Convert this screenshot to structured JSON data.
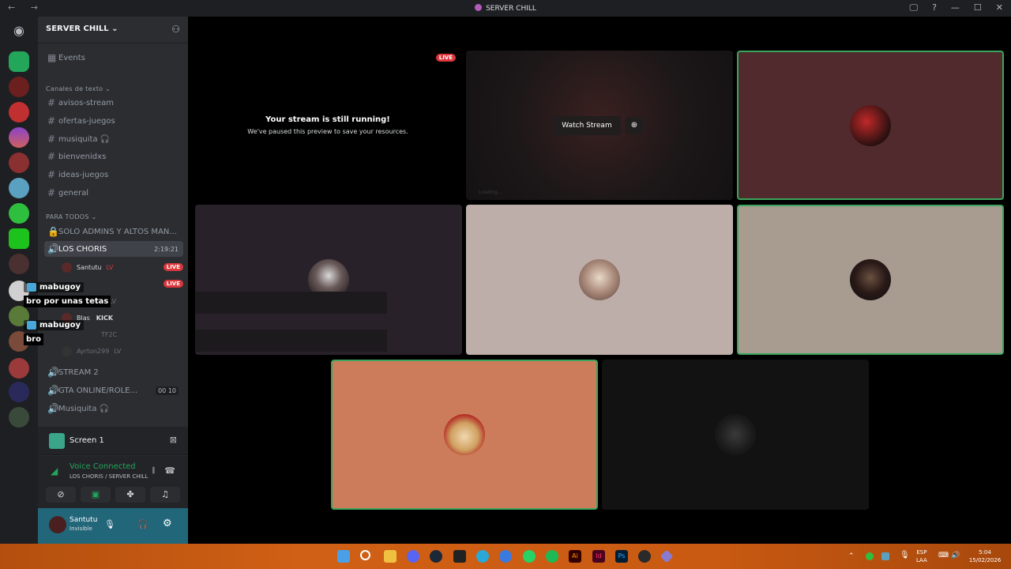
{
  "window": {
    "title": "SERVER CHILL",
    "nav_arrows": "← →",
    "controls": [
      "🖵",
      "?",
      "—",
      "☐",
      "✕"
    ]
  },
  "guild": {
    "name": "SERVER CHILL"
  },
  "sidebar": {
    "events_label": "Events",
    "category_text": "Canales de texto",
    "text_channels": [
      "avisos-stream",
      "ofertas-juegos",
      "musiquita 🎧",
      "bienvenidxs",
      "ideas-juegos",
      "general"
    ],
    "category_voice": "PARA TODOS",
    "locked_channel": "SOLO ADMINS Y ALTOS MAN...",
    "active_voice": {
      "name": "LOS CHORIS",
      "timer": "2:19:21",
      "users": [
        {
          "name": "Santutu",
          "badge": "LV",
          "status": "LIVE"
        },
        {
          "name": "",
          "badge": "",
          "status": "LIVE"
        },
        {
          "name": "",
          "badge": "LV",
          "status": ""
        },
        {
          "name": "Blas",
          "badge": "KICK",
          "status": ""
        },
        {
          "name": "",
          "badge": "TF2C",
          "status": ""
        },
        {
          "name": "Ayrton299",
          "badge": "LV",
          "status": ""
        }
      ]
    },
    "other_voice": [
      {
        "name": "STREAM 2",
        "counts": ""
      },
      {
        "name": "GTA ONLINE/ROLE...",
        "counts": [
          "00",
          "10"
        ]
      },
      {
        "name": "Musiquita 🎧",
        "counts": ""
      }
    ]
  },
  "chat_overlay": [
    {
      "user": "mabugoy",
      "message": "bro por unas tetas"
    },
    {
      "user": "mabugoy",
      "message": "bro"
    }
  ],
  "screen_panel": {
    "label": "Screen 1"
  },
  "voice_panel": {
    "status": "Voice Connected",
    "location": "LOS CHORIS / SERVER CHILL"
  },
  "user_panel": {
    "name": "Santutu",
    "status": "Invisible"
  },
  "stream_tile": {
    "live_badge": "LIVE",
    "heading": "Your stream is still running!",
    "subtext": "We've paused this preview to save your resources.",
    "watch_label": "Watch Stream",
    "loading_text": "Loading..."
  },
  "tiles": {
    "colors": {
      "maroon": "#512a2d",
      "dark": "#29212a",
      "lightgray": "#bdaeaa",
      "tan": "#a89c90",
      "salmon": "#cc7c5a",
      "black": "#121212",
      "speaking": "#3ba55d"
    }
  },
  "taskbar": {
    "lang": "ESP",
    "lang2": "LAA",
    "time": "5:04",
    "date": "15/02/2026"
  }
}
